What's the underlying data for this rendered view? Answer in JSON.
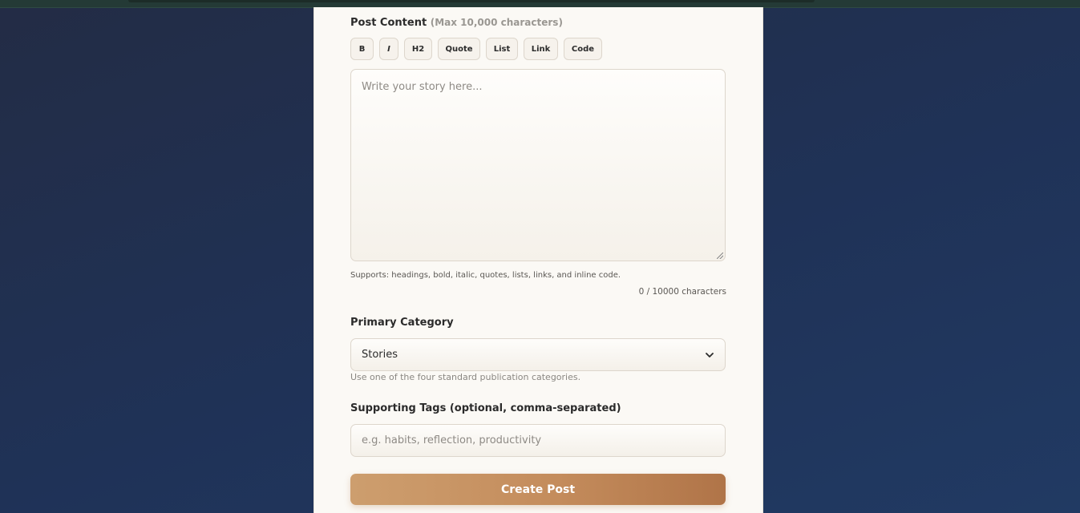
{
  "content_field": {
    "label": "Post Content",
    "hint": "(Max 10,000 characters)",
    "placeholder": "Write your story here...",
    "support_note": "Supports: headings, bold, italic, quotes, lists, links, and inline code.",
    "char_count": "0 / 10000 characters"
  },
  "toolbar": {
    "bold": "B",
    "italic": "I",
    "heading": "H2",
    "quote": "Quote",
    "list": "List",
    "link": "Link",
    "code": "Code"
  },
  "category_field": {
    "label": "Primary Category",
    "selected": "Stories",
    "hint": "Use one of the four standard publication categories."
  },
  "tags_field": {
    "label": "Supporting Tags (optional, comma-separated)",
    "placeholder": "e.g. habits, reflection, productivity"
  },
  "submit": {
    "label": "Create Post"
  },
  "colors": {
    "accent": "#c48c5c",
    "card_background": "#fbf9f5",
    "page_background": "#1f3257"
  }
}
